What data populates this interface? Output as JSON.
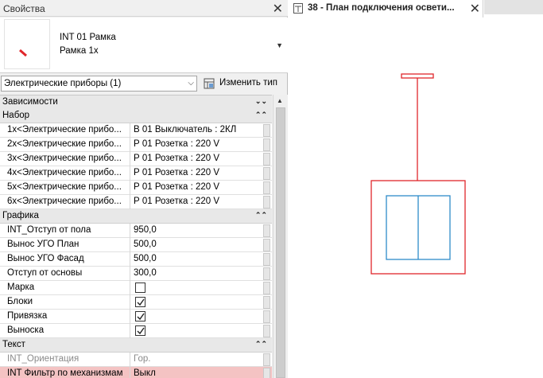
{
  "properties_panel": {
    "title": "Свойства",
    "type_selector": {
      "line1": "INT 01 Рамка",
      "line2": "Рамка 1х"
    },
    "filter": {
      "value": "Электрические приборы (1)",
      "edit_type_label": "Изменить тип"
    },
    "sections": [
      {
        "name": "Зависимости",
        "rows": []
      },
      {
        "name": "Набор",
        "rows": [
          {
            "key": "1х<Электрические прибо...",
            "value": "В 01 Выключатель : 2КЛ"
          },
          {
            "key": "2х<Электрические прибо...",
            "value": "Р 01 Розетка : 220 V"
          },
          {
            "key": "3х<Электрические прибо...",
            "value": "Р 01 Розетка : 220 V"
          },
          {
            "key": "4х<Электрические прибо...",
            "value": "Р 01 Розетка : 220 V"
          },
          {
            "key": "5х<Электрические прибо...",
            "value": "Р 01 Розетка : 220 V"
          },
          {
            "key": "6х<Электрические прибо...",
            "value": "Р 01 Розетка : 220 V"
          }
        ]
      },
      {
        "name": "Графика",
        "rows": [
          {
            "key": "INT_Отступ от пола",
            "value": "950,0"
          },
          {
            "key": "Вынос УГО План",
            "value": "500,0"
          },
          {
            "key": "Вынос УГО Фасад",
            "value": "500,0"
          },
          {
            "key": "Отступ от основы",
            "value": "300,0"
          },
          {
            "key": "Марка",
            "checked": false
          },
          {
            "key": "Блоки",
            "checked": true
          },
          {
            "key": "Привязка",
            "checked": true
          },
          {
            "key": "Выноска",
            "checked": true
          }
        ]
      },
      {
        "name": "Текст",
        "rows": [
          {
            "key": "INT_Ориентация",
            "value": "Гор."
          },
          {
            "key": "INT Фильтр по механизмам",
            "value": "Выкл"
          }
        ]
      }
    ]
  },
  "view_tab": {
    "label": "38 - План подключения освети..."
  },
  "colors": {
    "drawing_red": "#e0262b",
    "drawing_blue": "#2e8bc9",
    "highlight_row": "#f4c3c3"
  }
}
